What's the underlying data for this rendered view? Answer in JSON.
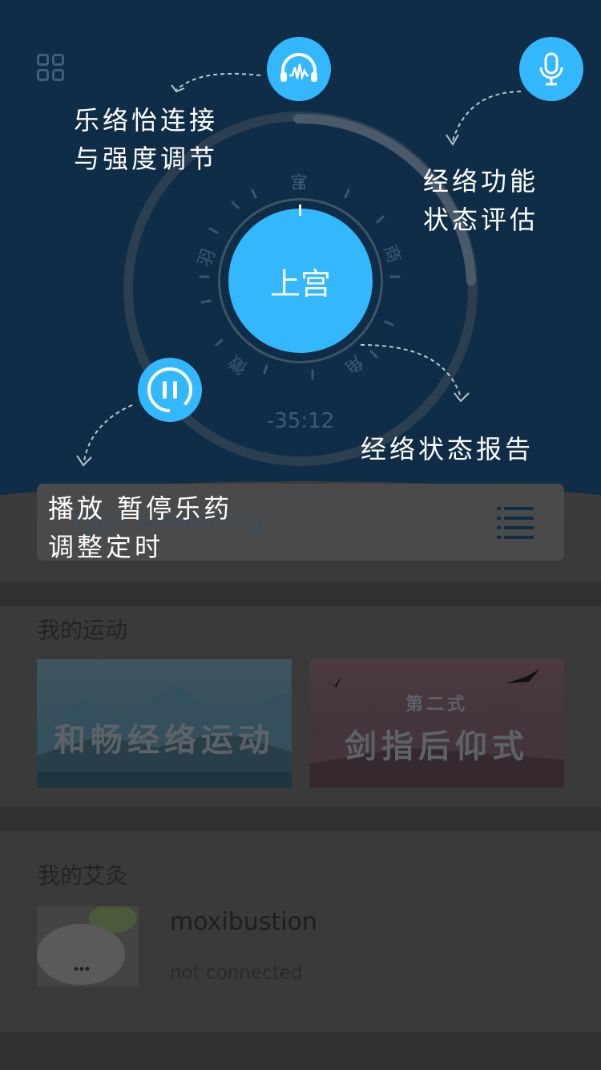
{
  "hero": {
    "center_label": "上宫",
    "timer": "-35:12",
    "dial_notes": [
      "宫",
      "商",
      "角",
      "徵",
      "羽"
    ]
  },
  "hints": {
    "connect": "乐络怡连接\n与强度调节",
    "assess": "经络功能\n状态评估",
    "report": "经络状态报告",
    "play": "播放 暂停乐药\n调整定时"
  },
  "search": {
    "placeholder": "Type something"
  },
  "exercise": {
    "title": "我的运动",
    "cards": [
      {
        "title": "和畅经络运动",
        "subtitle": ""
      },
      {
        "title": "剑指后仰式",
        "subtitle": "第二式"
      }
    ]
  },
  "moxa": {
    "title": "我的艾灸",
    "device_name": "moxibustion",
    "device_status": "not connected"
  },
  "colors": {
    "accent": "#33b7ff",
    "hero_bg": "#0f2d46"
  },
  "icons": [
    "menu-grid-icon",
    "headphone-wave-icon",
    "microphone-icon",
    "pause-icon",
    "list-icon"
  ]
}
